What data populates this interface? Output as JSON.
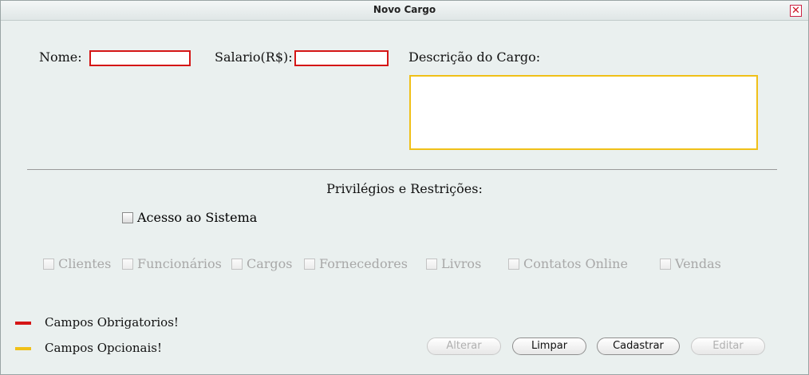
{
  "window": {
    "title": "Novo Cargo",
    "close_icon": "close-icon"
  },
  "form": {
    "nome_label": "Nome:",
    "nome_value": "",
    "salario_label": "Salario(R$):",
    "salario_value": "",
    "descricao_label": "Descrição do Cargo:",
    "descricao_value": ""
  },
  "privileges": {
    "title": "Privilégios e Restrições:",
    "acesso_label": "Acesso ao Sistema",
    "items": [
      "Clientes",
      "Funcionários",
      "Cargos",
      "Fornecedores",
      "Livros",
      "Contatos Online",
      "Vendas"
    ]
  },
  "legend": {
    "required_label": "Campos Obrigatorios!",
    "required_color": "#d51616",
    "optional_label": "Campos Opcionais!",
    "optional_color": "#f0c018"
  },
  "buttons": {
    "alterar": "Alterar",
    "limpar": "Limpar",
    "cadastrar": "Cadastrar",
    "editar": "Editar"
  }
}
